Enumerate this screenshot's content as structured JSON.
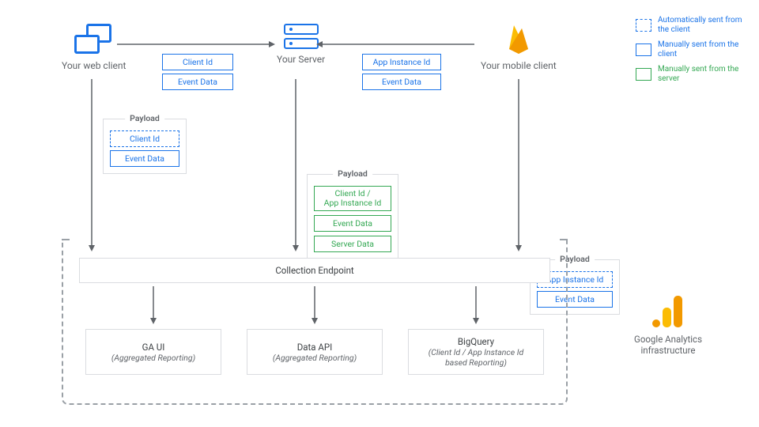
{
  "nodes": {
    "web_client": "Your web client",
    "server": "Your Server",
    "mobile_client": "Your mobile client"
  },
  "web_to_server": {
    "r0": "Client Id",
    "r1": "Event Data"
  },
  "mobile_to_server": {
    "r0": "App Instance Id",
    "r1": "Event Data"
  },
  "payload_label": "Payload",
  "payload_web": {
    "r0": "Client Id",
    "r1": "Event Data"
  },
  "payload_server": {
    "r0": "Client Id /\nApp Instance Id",
    "r1": "Event Data",
    "r2": "Server Data"
  },
  "payload_mobile": {
    "r0": "App Instance Id",
    "r1": "Event Data"
  },
  "collection_endpoint": "Collection Endpoint",
  "reports": {
    "ga_ui": {
      "title": "GA UI",
      "sub": "(Aggregated Reporting)"
    },
    "data_api": {
      "title": "Data API",
      "sub": "(Aggregated Reporting)"
    },
    "bigquery": {
      "title": "BigQuery",
      "sub": "(Client Id / App Instance Id based Reporting)"
    }
  },
  "infra_label": "Google Analytics infrastructure",
  "legend": {
    "auto_client": "Automatically sent from the client",
    "manual_client": "Manually sent from the client",
    "manual_server": "Manually sent from the server"
  },
  "colors": {
    "blue": "#1a73e8",
    "green": "#34a853",
    "orange_light": "#fbbc04",
    "orange_dark": "#f29900"
  }
}
